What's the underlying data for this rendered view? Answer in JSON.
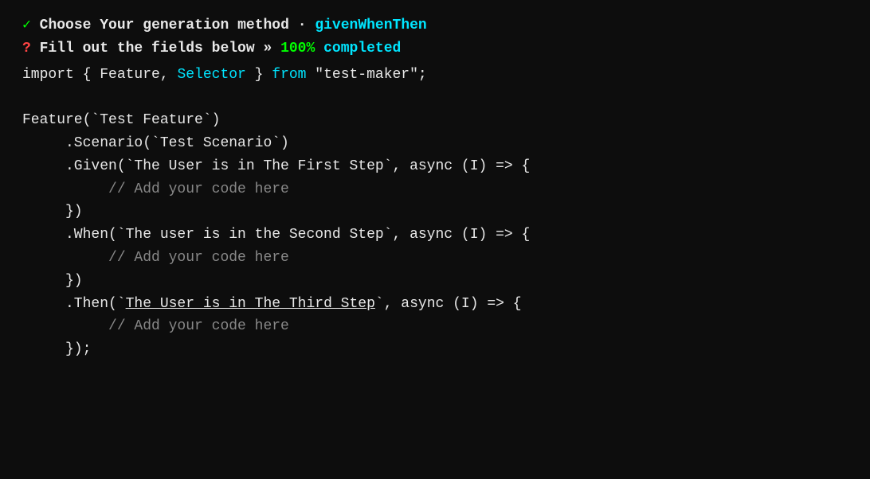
{
  "header": {
    "line1": {
      "checkmark": "✓",
      "text": " Choose Your generation method · ",
      "method": "givenWhenThen"
    },
    "line2": {
      "question": "?",
      "text_bold": " Fill out the fields below ",
      "arrow": "» ",
      "percent": "100%",
      "completed": " completed"
    }
  },
  "code": {
    "import_line": "import { Feature, Selector } from \"test-maker\";",
    "feature_call": "Feature(`Test Feature`)",
    "scenario": "     .Scenario(`Test Scenario`)",
    "given": "     .Given(`The User is in The First Step`, async (I) => {",
    "given_comment": "          // Add your code here",
    "given_close": "     })",
    "when": "     .When(`The user is in the Second Step`, async (I) => {",
    "when_comment": "          // Add your code here",
    "when_close": "     })",
    "then": "     .Then(`The User is in The Third Step`, async (I) => {",
    "then_comment": "          // Add your code here",
    "then_close": "     });"
  }
}
